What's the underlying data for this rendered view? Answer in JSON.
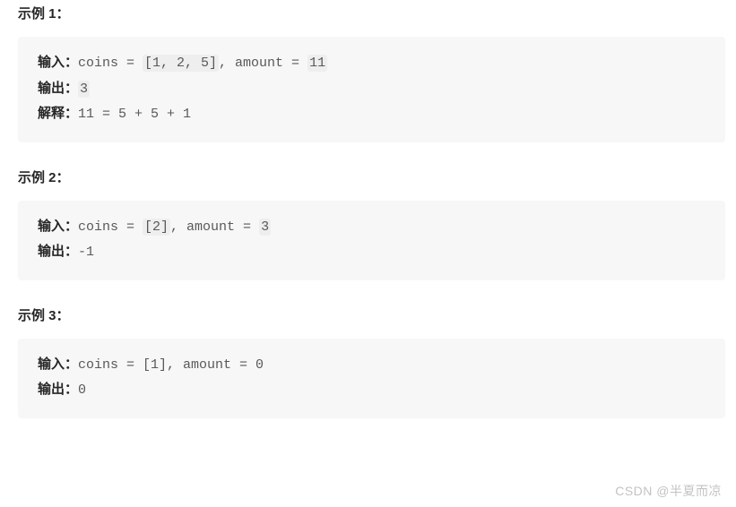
{
  "examples": [
    {
      "title": "示例 1：",
      "input_label": "输入：",
      "input_prefix": "coins = ",
      "input_hl1": "[1, 2, 5]",
      "input_mid": ", amount = ",
      "input_hl2": "11",
      "output_label": "输出：",
      "output_hl": "3",
      "output_plain": "",
      "has_explain": true,
      "explain_label": "解释：",
      "explain_text": "11 = 5 + 5 + 1"
    },
    {
      "title": "示例 2：",
      "input_label": "输入：",
      "input_prefix": "coins = ",
      "input_hl1": "[2]",
      "input_mid": ", amount = ",
      "input_hl2": "3",
      "output_label": "输出：",
      "output_hl": "",
      "output_plain": "-1",
      "has_explain": false,
      "explain_label": "",
      "explain_text": ""
    },
    {
      "title": "示例 3：",
      "input_label": "输入：",
      "input_prefix": "coins = [1], amount = 0",
      "input_hl1": "",
      "input_mid": "",
      "input_hl2": "",
      "output_label": "输出：",
      "output_hl": "",
      "output_plain": "0",
      "has_explain": false,
      "explain_label": "",
      "explain_text": ""
    }
  ],
  "watermark": "CSDN @半夏而凉"
}
